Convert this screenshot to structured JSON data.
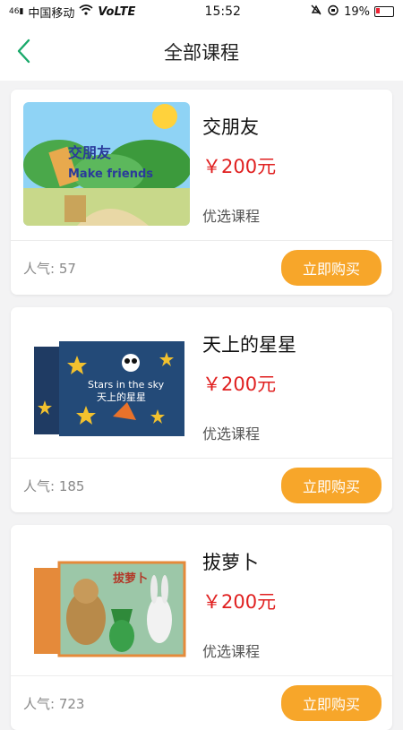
{
  "status": {
    "carrier": "中国移动",
    "volte": "VoLTE",
    "signal_prefix": "46",
    "time": "15:52",
    "battery": "19%"
  },
  "header": {
    "title": "全部课程"
  },
  "courses": [
    {
      "title": "交朋友",
      "price": "￥200元",
      "tag": "优选课程",
      "popularity": "人气: 57",
      "buy_label": "立即购买",
      "thumb_text_cn": "交朋友",
      "thumb_text_en": "Make friends"
    },
    {
      "title": "天上的星星",
      "price": "￥200元",
      "tag": "优选课程",
      "popularity": "人气: 185",
      "buy_label": "立即购买",
      "thumb_text_cn": "天上的星星",
      "thumb_text_en": "Stars in the sky"
    },
    {
      "title": "拔萝卜",
      "price": "￥200元",
      "tag": "优选课程",
      "popularity": "人气: 723",
      "buy_label": "立即购买",
      "thumb_text_cn": "拔萝卜"
    }
  ],
  "colors": {
    "accent": "#19a96a",
    "price": "#e02020",
    "button": "#f7a62a"
  }
}
